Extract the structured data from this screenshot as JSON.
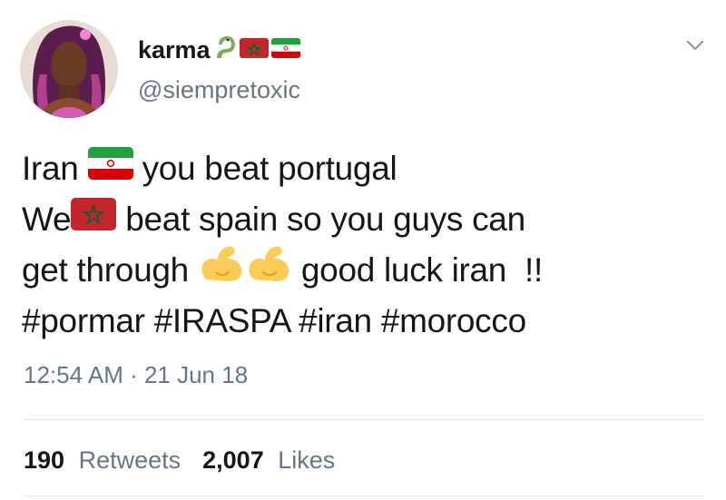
{
  "user": {
    "display_name": "karma",
    "handle": "@siempretoxic",
    "name_icons": [
      "snake-icon",
      "morocco-flag-icon",
      "iran-flag-icon"
    ]
  },
  "tweet": {
    "line1_a": "Iran",
    "line1_b": "you beat portugal",
    "line2_a": "We",
    "line2_b": "beat spain so you guys can",
    "line3_a": "get through",
    "line3_b": "good luck iran  !!",
    "line4": "#pormar #IRASPA #iran #morocco",
    "timestamp": "12:54 AM · 21 Jun 18"
  },
  "stats": {
    "retweets_count": "190",
    "retweets_label": "Retweets",
    "likes_count": "2,007",
    "likes_label": "Likes"
  },
  "colors": {
    "text": "#14171a",
    "secondary": "#657786",
    "divider": "#e1e8ed",
    "morocco_red": "#c1272d",
    "morocco_star": "#006233",
    "iran_green": "#239f40",
    "iran_red": "#da0000"
  }
}
